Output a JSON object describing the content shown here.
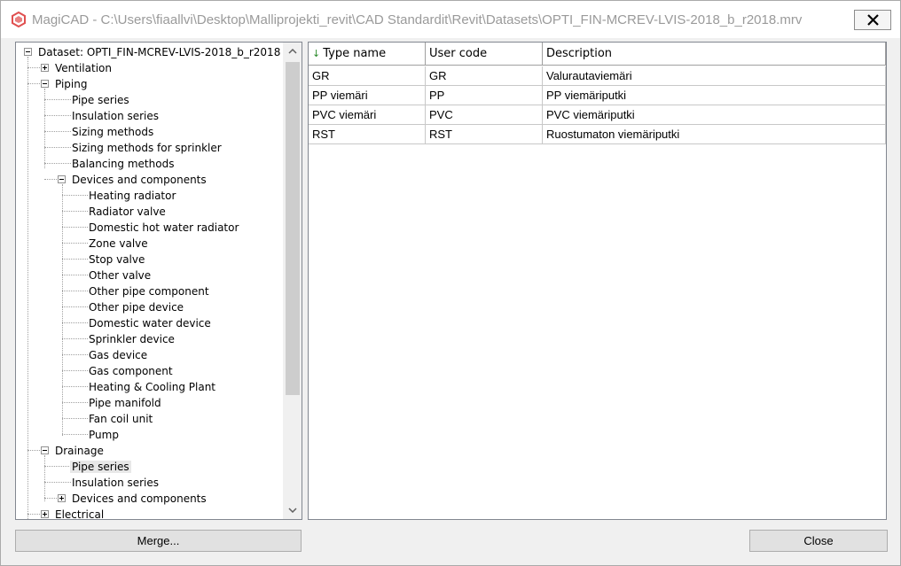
{
  "window": {
    "title": "MagiCAD - C:\\Users\\fiaallvi\\Desktop\\Malliprojekti_revit\\CAD Standardit\\Revit\\Datasets\\OPTI_FIN-MCREV-LVIS-2018_b_r2018.mrv",
    "app_icon": "magicad-logo-icon",
    "close_icon": "close-icon"
  },
  "tree": {
    "root": "Dataset: OPTI_FIN-MCREV-LVIS-2018_b_r2018",
    "ventilation": "Ventilation",
    "piping": "Piping",
    "piping_children": [
      "Pipe series",
      "Insulation series",
      "Sizing methods",
      "Sizing methods for sprinkler",
      "Balancing methods"
    ],
    "devices": "Devices and components",
    "device_children": [
      "Heating radiator",
      "Radiator valve",
      "Domestic hot water radiator",
      "Zone valve",
      "Stop valve",
      "Other valve",
      "Other pipe component",
      "Other pipe device",
      "Domestic water device",
      "Sprinkler device",
      "Gas device",
      "Gas component",
      "Heating & Cooling Plant",
      "Pipe manifold",
      "Fan coil unit",
      "Pump"
    ],
    "drainage": "Drainage",
    "drainage_children": [
      "Pipe series",
      "Insulation series"
    ],
    "drainage_devices": "Devices and components",
    "electrical": "Electrical",
    "scroll_up_icon": "chevron-up-icon",
    "scroll_down_icon": "chevron-down-icon"
  },
  "grid": {
    "sort_icon": "sort-down-arrow-icon",
    "columns": [
      "Type name",
      "User code",
      "Description"
    ],
    "rows": [
      [
        "GR",
        "GR",
        "Valurautaviemäri"
      ],
      [
        "PP viemäri",
        "PP",
        "PP viemäriputki"
      ],
      [
        "PVC viemäri",
        "PVC",
        "PVC viemäriputki"
      ],
      [
        "RST",
        "RST",
        "Ruostumaton viemäriputki"
      ]
    ]
  },
  "buttons": {
    "merge": "Merge...",
    "close": "Close"
  }
}
